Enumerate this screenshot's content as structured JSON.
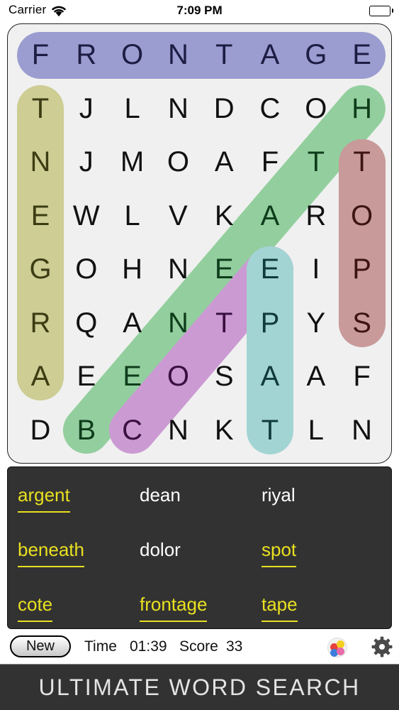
{
  "status_bar": {
    "carrier": "Carrier",
    "time": "7:09 PM",
    "wifi_icon": "wifi-icon",
    "battery_icon": "battery-icon"
  },
  "grid": {
    "rows": 8,
    "cols": 8,
    "letters": [
      [
        "F",
        "R",
        "O",
        "N",
        "T",
        "A",
        "G",
        "E"
      ],
      [
        "T",
        "J",
        "L",
        "N",
        "D",
        "C",
        "O",
        "H"
      ],
      [
        "N",
        "J",
        "M",
        "O",
        "A",
        "F",
        "T",
        "T"
      ],
      [
        "E",
        "W",
        "L",
        "V",
        "K",
        "A",
        "R",
        "O"
      ],
      [
        "G",
        "O",
        "H",
        "N",
        "E",
        "E",
        "I",
        "P"
      ],
      [
        "R",
        "Q",
        "A",
        "N",
        "T",
        "P",
        "Y",
        "S"
      ],
      [
        "A",
        "E",
        "E",
        "O",
        "S",
        "A",
        "A",
        "F"
      ],
      [
        "D",
        "B",
        "C",
        "N",
        "K",
        "T",
        "L",
        "N"
      ]
    ],
    "background_color": "#f0f0f0",
    "letter_color": "#111111",
    "highlights": [
      {
        "word": "frontage",
        "color": "#9b9cd0",
        "letter_color": "#1d1d44",
        "orientation": "horizontal",
        "start": [
          0,
          0
        ],
        "end": [
          0,
          7
        ]
      },
      {
        "word": "argent",
        "color": "#cdcd94",
        "letter_color": "#3c3c14",
        "orientation": "vertical",
        "start": [
          1,
          0
        ],
        "end": [
          6,
          0
        ]
      },
      {
        "word": "beneath",
        "color": "#93cf9e",
        "letter_color": "#0e3d1b",
        "orientation": "diagonal-up",
        "start": [
          7,
          1
        ],
        "end": [
          1,
          7
        ]
      },
      {
        "word": "cote",
        "color": "#cb9ad3",
        "letter_color": "#3a1040",
        "orientation": "diagonal-up",
        "start": [
          7,
          2
        ],
        "end": [
          4,
          5
        ]
      },
      {
        "word": "spot",
        "color": "#c89a9a",
        "letter_color": "#3d1414",
        "orientation": "vertical",
        "start": [
          2,
          7
        ],
        "end": [
          5,
          7
        ]
      },
      {
        "word": "tape",
        "color": "#a3d4d4",
        "letter_color": "#113a3a",
        "orientation": "vertical",
        "start": [
          4,
          5
        ],
        "end": [
          7,
          5
        ]
      }
    ]
  },
  "word_list": {
    "columns": 3,
    "words": [
      {
        "text": "argent",
        "found": true
      },
      {
        "text": "dean",
        "found": false
      },
      {
        "text": "riyal",
        "found": false
      },
      {
        "text": "beneath",
        "found": true
      },
      {
        "text": "dolor",
        "found": false
      },
      {
        "text": "spot",
        "found": true
      },
      {
        "text": "cote",
        "found": true
      },
      {
        "text": "frontage",
        "found": true
      },
      {
        "text": "tape",
        "found": true
      }
    ],
    "found_color": "#e8e020",
    "unfound_color": "#ffffff",
    "panel_color": "#333232"
  },
  "toolbar": {
    "new_label": "New",
    "time_label": "Time",
    "time_value": "01:39",
    "score_label": "Score",
    "score_value": "33",
    "palette_icon": "color-palette-icon",
    "gear_icon": "gear-icon"
  },
  "banner": {
    "title": "ULTIMATE WORD SEARCH",
    "background_color": "#333232",
    "text_color": "#e4e4e4"
  }
}
